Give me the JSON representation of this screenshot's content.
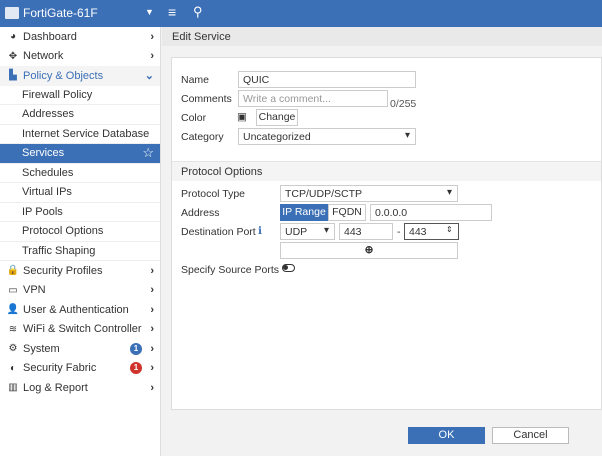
{
  "topbar": {
    "device": "FortiGate-61F"
  },
  "sidebar": {
    "items": [
      {
        "label": "Dashboard",
        "icon": "dashboard-icon",
        "glyph": "◕"
      },
      {
        "label": "Network",
        "icon": "network-icon",
        "glyph": "✥"
      },
      {
        "label": "Policy & Objects",
        "icon": "policy-icon",
        "glyph": "▙"
      },
      {
        "label": "Firewall Policy"
      },
      {
        "label": "Addresses"
      },
      {
        "label": "Internet Service Database"
      },
      {
        "label": "Services"
      },
      {
        "label": "Schedules"
      },
      {
        "label": "Virtual IPs"
      },
      {
        "label": "IP Pools"
      },
      {
        "label": "Protocol Options"
      },
      {
        "label": "Traffic Shaping"
      },
      {
        "label": "Security Profiles",
        "icon": "lock-icon",
        "glyph": "🔒"
      },
      {
        "label": "VPN",
        "icon": "laptop-icon",
        "glyph": "▭"
      },
      {
        "label": "User & Authentication",
        "icon": "user-icon",
        "glyph": "👤"
      },
      {
        "label": "WiFi & Switch Controller",
        "icon": "wifi-icon",
        "glyph": "≋"
      },
      {
        "label": "System",
        "icon": "gear-icon",
        "glyph": "⚙",
        "badge": "1",
        "badge_color": "#3b6fb6"
      },
      {
        "label": "Security Fabric",
        "icon": "fabric-icon",
        "glyph": "◐",
        "badge": "1",
        "badge_color": "#d0332b"
      },
      {
        "label": "Log & Report",
        "icon": "chart-icon",
        "glyph": "▥"
      }
    ]
  },
  "header": {
    "title": "Edit Service"
  },
  "form": {
    "name_label": "Name",
    "name_value": "QUIC",
    "comments_label": "Comments",
    "comments_placeholder": "Write a comment...",
    "comments_count": "0/255",
    "color_label": "Color",
    "change_button": "Change",
    "category_label": "Category",
    "category_value": "Uncategorized",
    "section": "Protocol Options",
    "protocol_type_label": "Protocol Type",
    "protocol_type_value": "TCP/UDP/SCTP",
    "address_label": "Address",
    "ip_range": "IP Range",
    "fqdn": "FQDN",
    "address_value": "0.0.0.0",
    "dest_port_label": "Destination Port",
    "port_protocol": "UDP",
    "port_low": "443",
    "dash": "-",
    "port_high": "443",
    "source_ports_label": "Specify Source Ports"
  },
  "footer": {
    "ok": "OK",
    "cancel": "Cancel"
  }
}
